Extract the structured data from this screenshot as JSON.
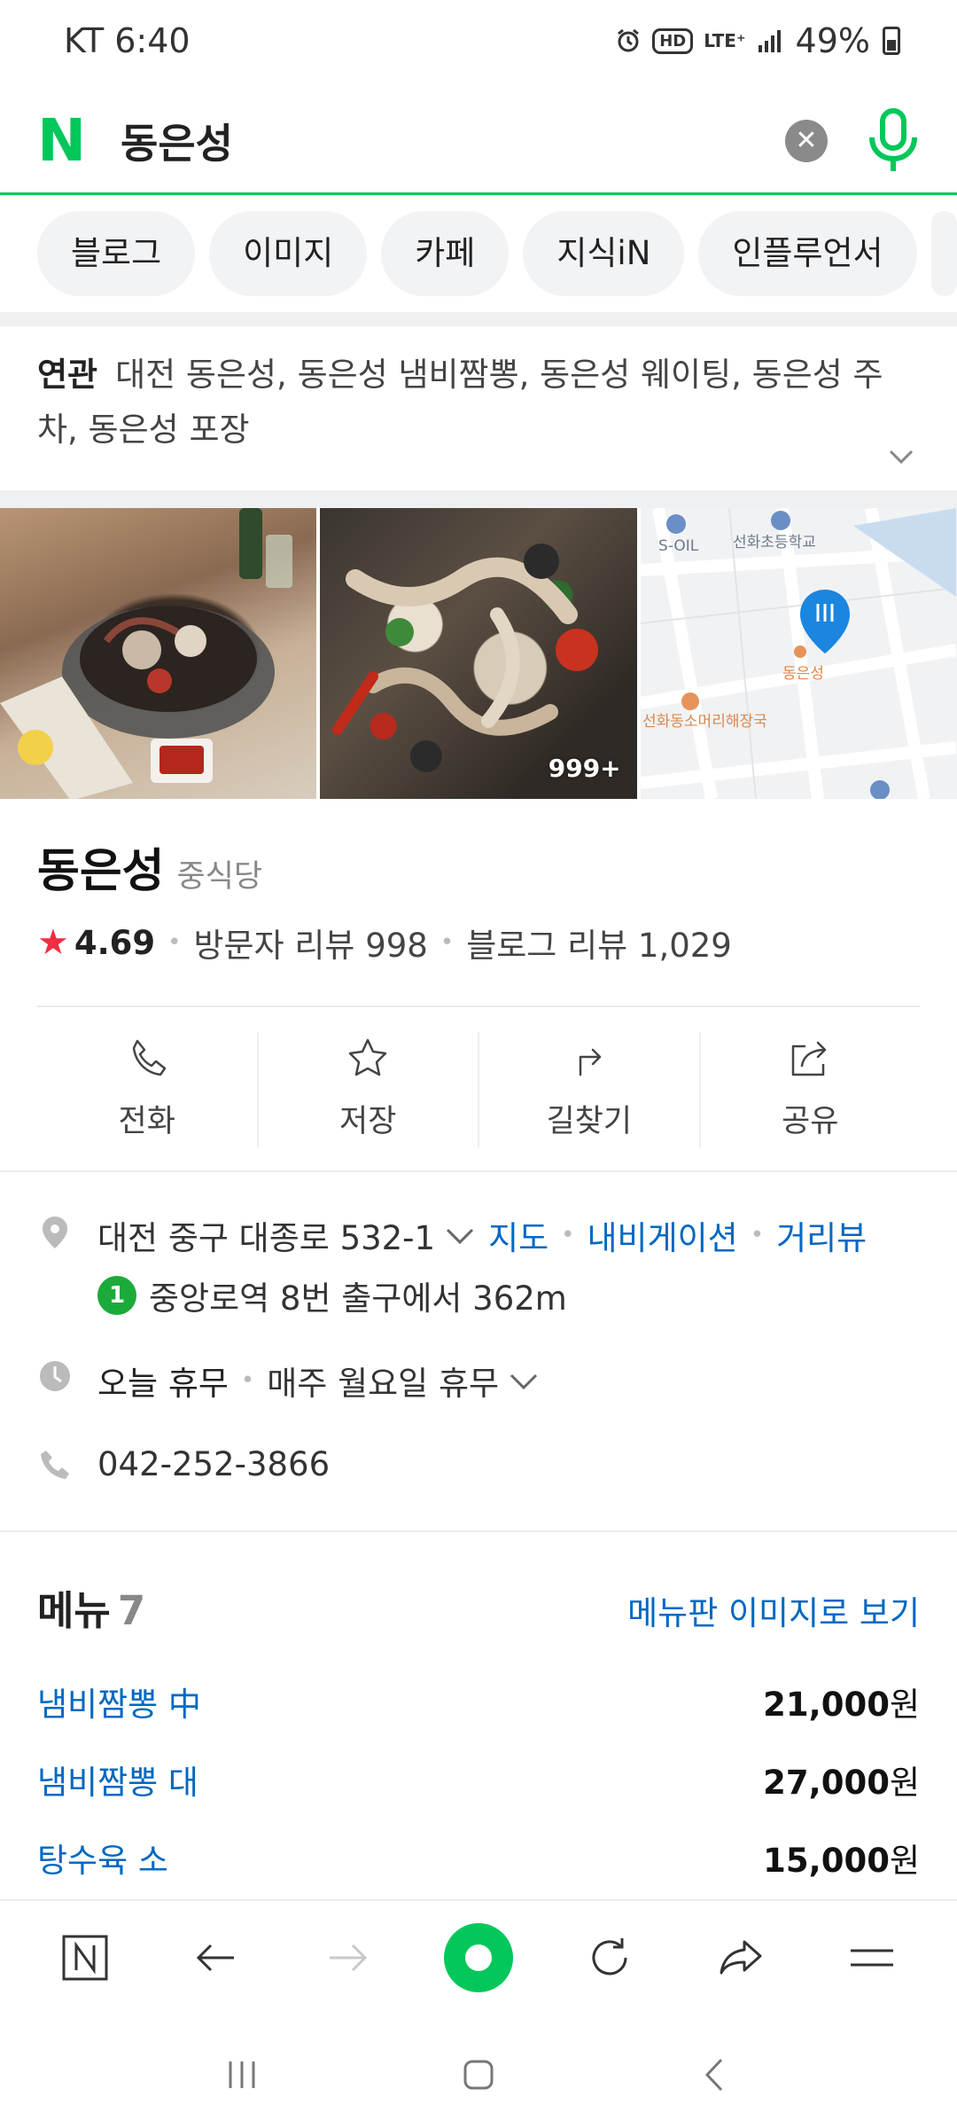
{
  "status_bar": {
    "carrier_time": "KT 6:40",
    "hd": "HD",
    "network": "LTE⁺",
    "battery": "49%"
  },
  "search": {
    "logo": "N",
    "query": "동은성"
  },
  "tabs": [
    "블로그",
    "이미지",
    "카페",
    "지식iN",
    "인플루언서"
  ],
  "related": {
    "label": "연관",
    "text": "대전 동은성, 동은성 냄비짬뽕, 동은성 웨이팅, 동은성 주차, 동은성 포장"
  },
  "photos": {
    "count_badge": "999+",
    "map_labels": {
      "gas": "S-OIL",
      "school": "선화초등학교",
      "place": "동은성",
      "restaurant": "선화동소머리해장국"
    }
  },
  "place": {
    "name": "동은성",
    "category": "중식당",
    "rating": "4.69",
    "visitor_reviews": "방문자 리뷰 998",
    "blog_reviews": "블로그 리뷰 1,029"
  },
  "actions": [
    {
      "label": "전화",
      "icon": "phone-icon"
    },
    {
      "label": "저장",
      "icon": "star-icon"
    },
    {
      "label": "길찾기",
      "icon": "directions-icon"
    },
    {
      "label": "공유",
      "icon": "share-icon"
    }
  ],
  "info": {
    "address": "대전 중구 대종로 532-1",
    "map_link": "지도",
    "navi_link": "내비게이션",
    "street_link": "거리뷰",
    "subway_line": "1",
    "subway_text": "중앙로역 8번 출구에서 362m",
    "hours_status": "오늘 휴무",
    "hours_detail": "매주 월요일 휴무",
    "phone": "042-252-3866"
  },
  "menu": {
    "title": "메뉴",
    "count": "7",
    "image_link": "메뉴판 이미지로 보기",
    "items": [
      {
        "name": "냄비짬뽕 中",
        "price": "21,000",
        "unit": "원"
      },
      {
        "name": "냄비짬뽕 대",
        "price": "27,000",
        "unit": "원"
      },
      {
        "name": "탕수육 소",
        "price": "15,000",
        "unit": "원"
      }
    ]
  },
  "colors": {
    "brand": "#03c75a",
    "link": "#0068c3",
    "star": "#f22c42"
  }
}
